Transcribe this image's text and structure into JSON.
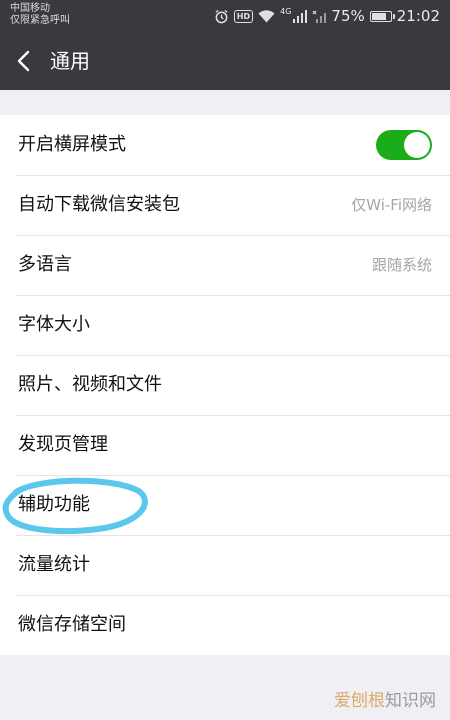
{
  "status_bar": {
    "carrier_line1": "中国移动",
    "carrier_line2": "仅限紧急呼叫",
    "hd": "HD",
    "net_tag": "4G",
    "battery_text": "75%",
    "battery_level": 0.75,
    "time": "21:02",
    "icons": [
      "alarm-icon",
      "hd-icon",
      "wifi-icon",
      "signal-icon",
      "no-signal-icon",
      "battery-icon"
    ]
  },
  "header": {
    "title": "通用",
    "back_icon": "chevron-left-icon"
  },
  "settings": {
    "items": [
      {
        "label": "开启横屏模式",
        "toggle_on": true
      },
      {
        "label": "自动下载微信安装包",
        "value": "仅Wi-Fi网络"
      },
      {
        "label": "多语言",
        "value": "跟随系统"
      },
      {
        "label": "字体大小"
      },
      {
        "label": "照片、视频和文件"
      },
      {
        "label": "发现页管理"
      },
      {
        "label": "辅助功能"
      },
      {
        "label": "流量统计"
      },
      {
        "label": "微信存储空间"
      }
    ]
  },
  "watermark": {
    "part_a": "爱刨根",
    "part_b": "知识网"
  },
  "colors": {
    "bar_bg": "#393a3f",
    "accent_green": "#1aad19",
    "page_bg": "#efeff4",
    "highlight_ring": "#5cc7ec"
  }
}
